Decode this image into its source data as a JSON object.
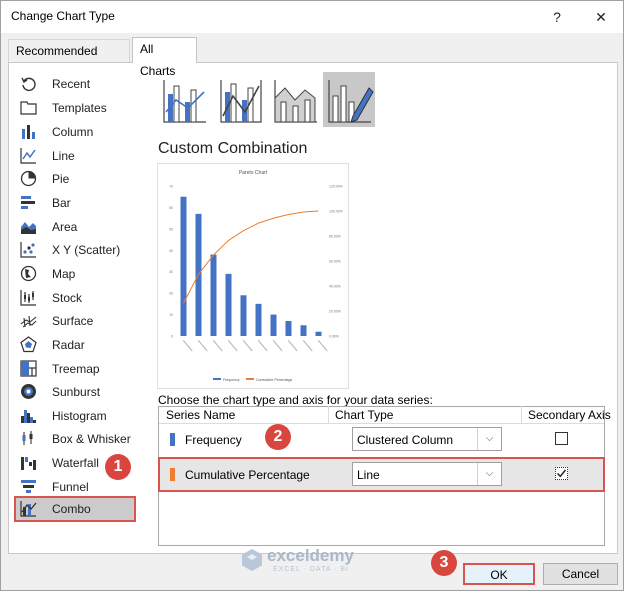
{
  "window": {
    "title": "Change Chart Type",
    "help_glyph": "?",
    "close_glyph": "✕"
  },
  "tabs": [
    {
      "label": "Recommended Charts",
      "active": false
    },
    {
      "label": "All Charts",
      "active": true
    }
  ],
  "categories": [
    {
      "label": "Recent",
      "icon": "recent-icon"
    },
    {
      "label": "Templates",
      "icon": "templates-icon"
    },
    {
      "label": "Column",
      "icon": "column-chart-icon"
    },
    {
      "label": "Line",
      "icon": "line-chart-icon"
    },
    {
      "label": "Pie",
      "icon": "pie-chart-icon"
    },
    {
      "label": "Bar",
      "icon": "bar-chart-icon"
    },
    {
      "label": "Area",
      "icon": "area-chart-icon"
    },
    {
      "label": "X Y (Scatter)",
      "icon": "scatter-chart-icon"
    },
    {
      "label": "Map",
      "icon": "map-chart-icon"
    },
    {
      "label": "Stock",
      "icon": "stock-chart-icon"
    },
    {
      "label": "Surface",
      "icon": "surface-chart-icon"
    },
    {
      "label": "Radar",
      "icon": "radar-chart-icon"
    },
    {
      "label": "Treemap",
      "icon": "treemap-chart-icon"
    },
    {
      "label": "Sunburst",
      "icon": "sunburst-chart-icon"
    },
    {
      "label": "Histogram",
      "icon": "histogram-chart-icon"
    },
    {
      "label": "Box & Whisker",
      "icon": "box-whisker-chart-icon"
    },
    {
      "label": "Waterfall",
      "icon": "waterfall-chart-icon"
    },
    {
      "label": "Funnel",
      "icon": "funnel-chart-icon"
    },
    {
      "label": "Combo",
      "icon": "combo-chart-icon",
      "selected": true
    }
  ],
  "combo_subtype_title": "Custom Combination",
  "preview": {
    "title": "Pareto Chart",
    "legend": [
      "Frequency",
      "Cumulative Percentage"
    ],
    "left_axis_ticks": [
      "0",
      "10",
      "20",
      "30",
      "40",
      "50",
      "60",
      "70"
    ],
    "right_axis_ticks": [
      "0.00%",
      "20.00%",
      "40.00%",
      "60.00%",
      "80.00%",
      "100.00%",
      "120.00%"
    ]
  },
  "series_section": {
    "prompt": "Choose the chart type and axis for your data series:",
    "headers": {
      "name": "Series Name",
      "type": "Chart Type",
      "secondary": "Secondary Axis"
    },
    "rows": [
      {
        "name": "Frequency",
        "color": "#4472c4",
        "chart_type": "Clustered Column",
        "secondary_axis": false
      },
      {
        "name": "Cumulative Percentage",
        "color": "#ed7d31",
        "chart_type": "Line",
        "secondary_axis": true
      }
    ]
  },
  "steps": [
    "1",
    "2",
    "3"
  ],
  "buttons": {
    "ok": "OK",
    "cancel": "Cancel"
  },
  "watermark": {
    "name": "exceldemy",
    "tagline": "EXCEL · DATA · BI"
  },
  "colors": {
    "accent_red": "#d9463f",
    "bar_blue": "#4472c4",
    "line_orange": "#ed7d31"
  }
}
